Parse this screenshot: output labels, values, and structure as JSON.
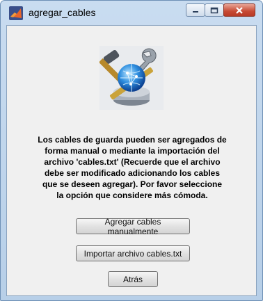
{
  "window": {
    "title": "agregar_cables",
    "controls": {
      "minimize": "minimize",
      "maximize": "maximize",
      "close": "close"
    }
  },
  "illustration": {
    "icon": "tools-network-globe-icon"
  },
  "message": {
    "lines": [
      "Los cables de guarda pueden ser agregados de",
      "forma manual o mediante la importación del",
      "archivo 'cables.txt' (Recuerde que el archivo",
      "debe ser modificado adicionando los cables",
      "que se deseen agregar).  Por favor seleccione",
      "la opción que considere más cómoda."
    ]
  },
  "buttons": {
    "manual": "Agregar cables manualmente",
    "import": "Importar archivo cables.txt",
    "back": "Atrás"
  },
  "colors": {
    "titlebar": "#c9dcf0",
    "client": "#f0f0f0",
    "close": "#c74a34"
  }
}
